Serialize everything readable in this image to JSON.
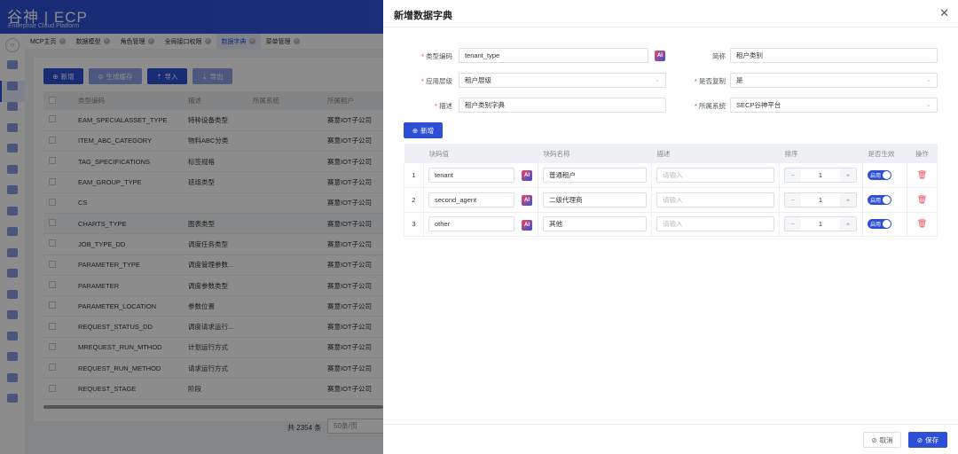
{
  "app": {
    "logo": "谷神",
    "logo_product": "ECP",
    "logo_sub": "Enterprise Cloud Platform"
  },
  "tabs": [
    {
      "label": "MCP主页"
    },
    {
      "label": "数据模型"
    },
    {
      "label": "角色管理"
    },
    {
      "label": "全局接口权限"
    },
    {
      "label": "数据字典",
      "active": true
    },
    {
      "label": "菜单管理"
    }
  ],
  "toolbar": {
    "add": "新增",
    "cache": "生成缓存",
    "import": "导入",
    "export": "导出"
  },
  "list": {
    "headers": [
      "类型编码",
      "描述",
      "所属系统",
      "所属租户"
    ],
    "rows": [
      [
        "EAM_SPECIALASSET_TYPE",
        "特种设备类型",
        "",
        "赛意IOT子公司"
      ],
      [
        "ITEM_ABC_CATEGORY",
        "物料ABC分类",
        "",
        "赛意IOT子公司"
      ],
      [
        "TAG_SPECIFICATIONS",
        "标签规格",
        "",
        "赛意IOT子公司"
      ],
      [
        "EAM_GROUP_TYPE",
        "班组类型",
        "",
        "赛意IOT子公司"
      ],
      [
        "CS",
        "",
        "",
        "赛意IOT子公司"
      ],
      [
        "CHARTS_TYPE",
        "图表类型",
        "",
        "赛意IOT子公司"
      ],
      [
        "JOB_TYPE_DD",
        "调度任务类型",
        "",
        "赛意IOT子公司"
      ],
      [
        "PARAMETER_TYPE",
        "调度管理参数...",
        "",
        "赛意IOT子公司"
      ],
      [
        "PARAMETER",
        "调度参数类型",
        "",
        "赛意IOT子公司"
      ],
      [
        "PARAMETER_LOCATION",
        "参数位置",
        "",
        "赛意IOT子公司"
      ],
      [
        "REQUEST_STATUS_DD",
        "调度请求运行...",
        "",
        "赛意IOT子公司"
      ],
      [
        "MREQUEST_RUN_MTHOD",
        "计划运行方式",
        "",
        "赛意IOT子公司"
      ],
      [
        "REQUEST_RUN_METHOD",
        "请求运行方式",
        "",
        "赛意IOT子公司"
      ],
      [
        "REQUEST_STAGE",
        "阶段",
        "",
        "赛意IOT子公司"
      ]
    ],
    "total": "共 2354 条",
    "page_size": "50条/页"
  },
  "drawer": {
    "title": "新增数据字典",
    "form": {
      "type_code_label": "类型编码",
      "type_code": "tenant_type",
      "short_label": "简称",
      "short": "租户类别",
      "level_label": "应用层级",
      "level": "租户层级",
      "copy_label": "是否复制",
      "copy": "是",
      "desc_label": "描述",
      "desc": "租户类别字典",
      "system_label": "所属系统",
      "system": "SECP谷神平台"
    },
    "add": "新增",
    "headers": [
      "",
      "块码值",
      "块码名称",
      "描述",
      "排序",
      "是否生效",
      "操作"
    ],
    "rows": [
      {
        "idx": "1",
        "code": "tenant",
        "name": "普通租户",
        "desc_ph": "请输入",
        "sort": "1",
        "enabled": "启用"
      },
      {
        "idx": "2",
        "code": "second_agent",
        "name": "二级代理商",
        "desc_ph": "请输入",
        "sort": "1",
        "enabled": "启用"
      },
      {
        "idx": "3",
        "code": "other",
        "name": "其他",
        "desc_ph": "请输入",
        "sort": "1",
        "enabled": "启用"
      }
    ],
    "ai": "AI",
    "cancel": "取消",
    "save": "保存"
  }
}
